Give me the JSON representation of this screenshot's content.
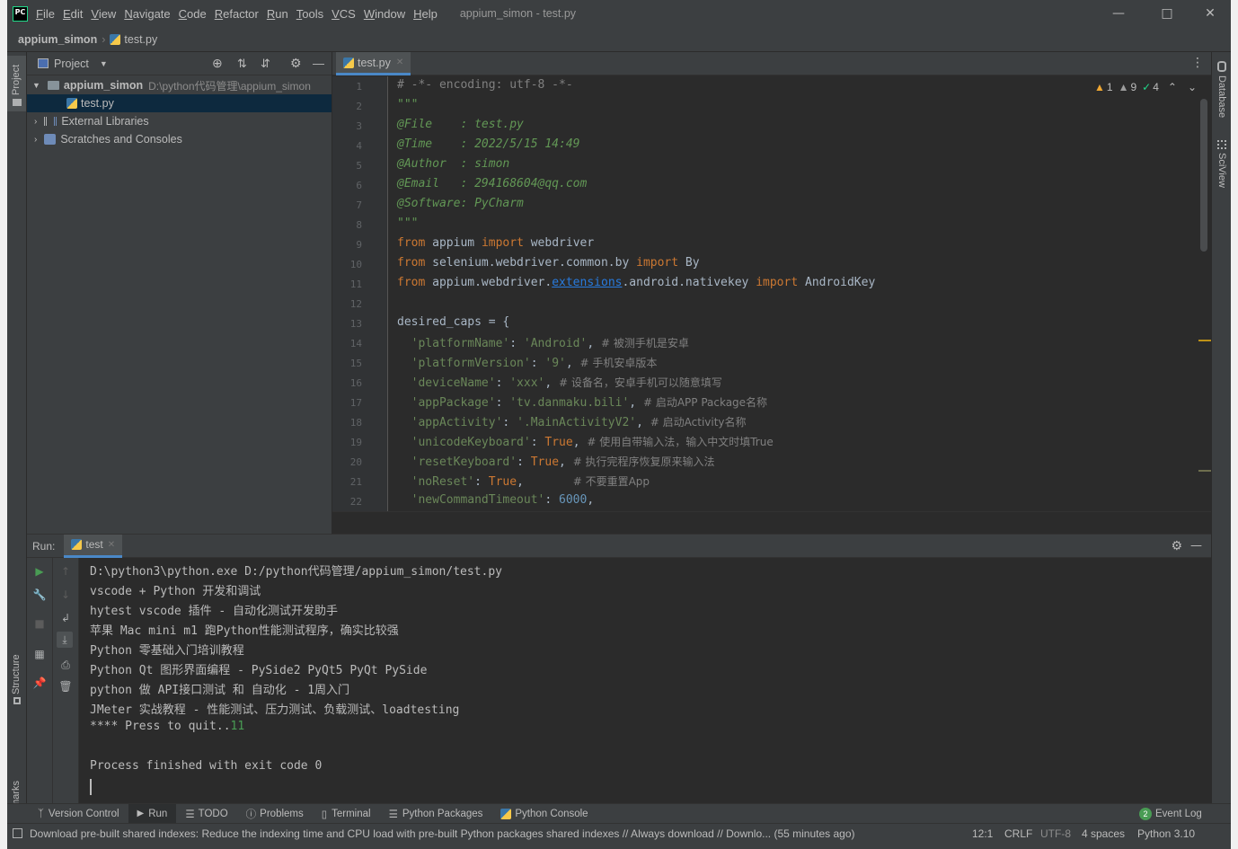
{
  "titlebar": {
    "menu": [
      "File",
      "Edit",
      "View",
      "Navigate",
      "Code",
      "Refactor",
      "Run",
      "Tools",
      "VCS",
      "Window",
      "Help"
    ],
    "title": "appium_simon - test.py"
  },
  "navbar": {
    "project": "appium_simon",
    "file": "test.py",
    "run_config": "test"
  },
  "left_stripe": {
    "project": "Project",
    "structure": "Structure",
    "bookmarks": "Bookmarks"
  },
  "right_stripe": {
    "database": "Database",
    "sciview": "SciView"
  },
  "project_panel": {
    "title": "Project",
    "root_name": "appium_simon",
    "root_path": "D:\\python代码管理\\appium_simon",
    "file": "test.py",
    "external": "External Libraries",
    "scratches": "Scratches and Consoles"
  },
  "editor": {
    "tab": "test.py",
    "inspections": {
      "warnings": "1",
      "weak": "9",
      "ok": "4"
    },
    "line_numbers": [
      "1",
      "2",
      "3",
      "4",
      "5",
      "6",
      "7",
      "8",
      "9",
      "10",
      "11",
      "12",
      "13",
      "14",
      "15",
      "16",
      "17",
      "18",
      "19",
      "20",
      "21",
      "22"
    ]
  },
  "code": {
    "l1": "# -*- encoding: utf-8 -*-",
    "l2": "\"\"\"",
    "l3": "@File    : test.py",
    "l4": "@Time    : 2022/5/15 14:49",
    "l5": "@Author  : simon",
    "l6": "@Email   : 294168604@qq.com",
    "l7": "@Software: PyCharm",
    "l8": "\"\"\"",
    "l9a": "from",
    "l9b": " appium ",
    "l9c": "import",
    "l9d": " webdriver",
    "l10a": "from",
    "l10b": " selenium.webdriver.common.by ",
    "l10c": "import",
    "l10d": " By",
    "l11a": "from",
    "l11b": " appium.webdriver.",
    "l11c": "extensions",
    "l11d": ".android.nativekey ",
    "l11e": "import",
    "l11f": " AndroidKey",
    "l13": "desired_caps = {",
    "l14k": "'platformName'",
    "l14v": "'Android'",
    "l14c": "# 被测手机是安卓",
    "l15k": "'platformVersion'",
    "l15v": "'9'",
    "l15c": "# 手机安卓版本",
    "l16k": "'deviceName'",
    "l16v": "'xxx'",
    "l16c": "# 设备名，安卓手机可以随意填写",
    "l17k": "'appPackage'",
    "l17v": "'tv.danmaku.bili'",
    "l17c": "# 启动APP Package名称",
    "l18k": "'appActivity'",
    "l18v": "'.MainActivityV2'",
    "l18c": "# 启动Activity名称",
    "l19k": "'unicodeKeyboard'",
    "l19v": "True",
    "l19c": "# 使用自带输入法，输入中文时填True",
    "l20k": "'resetKeyboard'",
    "l20v": "True",
    "l20c": "# 执行完程序恢复原来输入法",
    "l21k": "'noReset'",
    "l21v": "True",
    "l21c": "# 不要重置App",
    "l22k": "'newCommandTimeout'",
    "l22v": "6000"
  },
  "run": {
    "label": "Run:",
    "tab": "test",
    "lines": [
      "D:\\python3\\python.exe D:/python代码管理/appium_simon/test.py",
      "vscode + Python 开发和调试",
      "hytest vscode 插件 - 自动化测试开发助手",
      "苹果 Mac mini m1 跑Python性能测试程序，确实比较强",
      "Python 零基础入门培训教程",
      "Python Qt 图形界面编程 - PySide2 PyQt5 PyQt PySide",
      "python 做 API接口测试 和 自动化 - 1周入门",
      "JMeter 实战教程 - 性能测试、压力测试、负载测试、loadtesting",
      "**** Press to quit..",
      "Process finished with exit code 0"
    ],
    "input_echo": "11"
  },
  "bottom_tabs": [
    "Version Control",
    "Run",
    "TODO",
    "Problems",
    "Terminal",
    "Python Packages",
    "Python Console"
  ],
  "event_log": {
    "count": "2",
    "label": "Event Log"
  },
  "status": {
    "message": "Download pre-built shared indexes: Reduce the indexing time and CPU load with pre-built Python packages shared indexes // Always download // Downlo... (55 minutes ago)",
    "position": "12:1",
    "line_sep": "CRLF",
    "encoding": "UTF-8",
    "indent": "4 spaces",
    "interpreter": "Python 3.10"
  }
}
